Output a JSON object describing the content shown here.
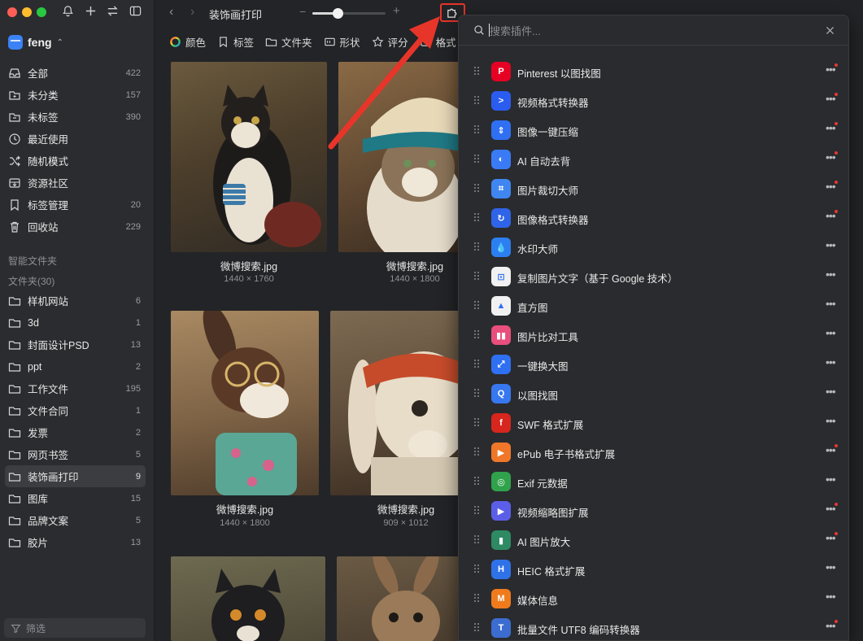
{
  "library": {
    "name": "feng"
  },
  "sidebar": {
    "items": [
      {
        "label": "全部",
        "count": "422",
        "icon": "tray-icon"
      },
      {
        "label": "未分类",
        "count": "157",
        "icon": "uncategorized-icon"
      },
      {
        "label": "未标签",
        "count": "390",
        "icon": "untagged-icon"
      },
      {
        "label": "最近使用",
        "count": "",
        "icon": "clock-icon"
      },
      {
        "label": "随机模式",
        "count": "",
        "icon": "shuffle-icon"
      },
      {
        "label": "资源社区",
        "count": "",
        "icon": "community-icon"
      },
      {
        "label": "标签管理",
        "count": "20",
        "icon": "bookmark-icon"
      },
      {
        "label": "回收站",
        "count": "229",
        "icon": "trash-icon"
      }
    ],
    "smart_folders_label": "智能文件夹",
    "folders_label": "文件夹(30)",
    "folders": [
      {
        "label": "样机网站",
        "count": "6"
      },
      {
        "label": "3d",
        "count": "1"
      },
      {
        "label": "封面设计PSD",
        "count": "13"
      },
      {
        "label": "ppt",
        "count": "2"
      },
      {
        "label": "工作文件",
        "count": "195"
      },
      {
        "label": "文件合同",
        "count": "1"
      },
      {
        "label": "发票",
        "count": "2"
      },
      {
        "label": "网页书签",
        "count": "5"
      },
      {
        "label": "装饰画打印",
        "count": "9",
        "active": true
      },
      {
        "label": "图库",
        "count": "15"
      },
      {
        "label": "品牌文案",
        "count": "5"
      },
      {
        "label": "胶片",
        "count": "13"
      }
    ],
    "filter_placeholder": "筛选"
  },
  "topbar": {
    "folder_title": "装饰画打印",
    "zoom_level": 0.34
  },
  "filterbar": {
    "items": [
      {
        "label": "颜色",
        "icon": "color-wheel-icon"
      },
      {
        "label": "标签",
        "icon": "bookmark-icon"
      },
      {
        "label": "文件夹",
        "icon": "folder-icon"
      },
      {
        "label": "形状",
        "icon": "shape-icon"
      },
      {
        "label": "评分",
        "icon": "star-icon"
      },
      {
        "label": "格式",
        "icon": "format-icon"
      }
    ]
  },
  "grid": {
    "items": [
      {
        "name": "微博搜索.jpg",
        "size": "1440 × 1760"
      },
      {
        "name": "微博搜索.jpg",
        "size": "1440 × 1800"
      },
      {
        "name": "微博搜索.jpg",
        "size": "1440 × 1800"
      },
      {
        "name": "微博搜索.jpg",
        "size": "909 × 1012"
      },
      {
        "name": "",
        "size": ""
      },
      {
        "name": "",
        "size": ""
      }
    ]
  },
  "plugins": {
    "search_placeholder": "搜索插件...",
    "items": [
      {
        "name": "Pinterest 以图找图",
        "icon": "pinterest-icon",
        "color": "#e60023",
        "glyph": "P",
        "dot": true
      },
      {
        "name": "视频格式转换器",
        "icon": "video-convert-icon",
        "color": "#2b5cf0",
        "glyph": ">",
        "dot": true
      },
      {
        "name": "图像一键压缩",
        "icon": "compress-icon",
        "color": "#2f6ff2",
        "glyph": "⇕",
        "dot": true
      },
      {
        "name": "AI 自动去背",
        "icon": "ai-remove-bg-icon",
        "color": "#3a7bf5",
        "glyph": "◐",
        "dot": true
      },
      {
        "name": "图片裁切大师",
        "icon": "crop-icon",
        "color": "#3f86f0",
        "glyph": "⌗",
        "dot": true
      },
      {
        "name": "图像格式转换器",
        "icon": "image-convert-icon",
        "color": "#2f64e8",
        "glyph": "↻",
        "dot": true
      },
      {
        "name": "水印大师",
        "icon": "watermark-icon",
        "color": "#2c7ff0",
        "glyph": "💧",
        "dot": false
      },
      {
        "name": "复制图片文字（基于 Google 技术）",
        "icon": "ocr-icon",
        "color": "#f1f1f1",
        "glyph": "⊡",
        "dot": false
      },
      {
        "name": "直方图",
        "icon": "histogram-icon",
        "color": "#f1f1f1",
        "glyph": "▲",
        "dot": false
      },
      {
        "name": "图片比对工具",
        "icon": "compare-icon",
        "color": "#e94f7d",
        "glyph": "▮▮",
        "dot": false
      },
      {
        "name": "一键换大图",
        "icon": "enlarge-icon",
        "color": "#2f6ff2",
        "glyph": "⤢",
        "dot": false
      },
      {
        "name": "以图找图",
        "icon": "search-by-image-icon",
        "color": "#3777f0",
        "glyph": "Q",
        "dot": false
      },
      {
        "name": "SWF 格式扩展",
        "icon": "swf-icon",
        "color": "#d7261e",
        "glyph": "f",
        "dot": false
      },
      {
        "name": "ePub 电子书格式扩展",
        "icon": "epub-icon",
        "color": "#f0772a",
        "glyph": "▶",
        "dot": true
      },
      {
        "name": "Exif 元数据",
        "icon": "exif-icon",
        "color": "#2fa24b",
        "glyph": "◎",
        "dot": false
      },
      {
        "name": "视频缩略图扩展",
        "icon": "video-thumb-icon",
        "color": "#5b5fe8",
        "glyph": "▶",
        "dot": true
      },
      {
        "name": "AI 图片放大",
        "icon": "ai-upscale-icon",
        "color": "#2e8a63",
        "glyph": "▮",
        "dot": true
      },
      {
        "name": "HEIC 格式扩展",
        "icon": "heic-icon",
        "color": "#2f72e8",
        "glyph": "H",
        "dot": false
      },
      {
        "name": "媒体信息",
        "icon": "media-info-icon",
        "color": "#ef7b1d",
        "glyph": "M",
        "dot": false
      },
      {
        "name": "批量文件 UTF8 编码转换器",
        "icon": "utf8-icon",
        "color": "#3c6ccf",
        "glyph": "T",
        "dot": true
      }
    ]
  }
}
